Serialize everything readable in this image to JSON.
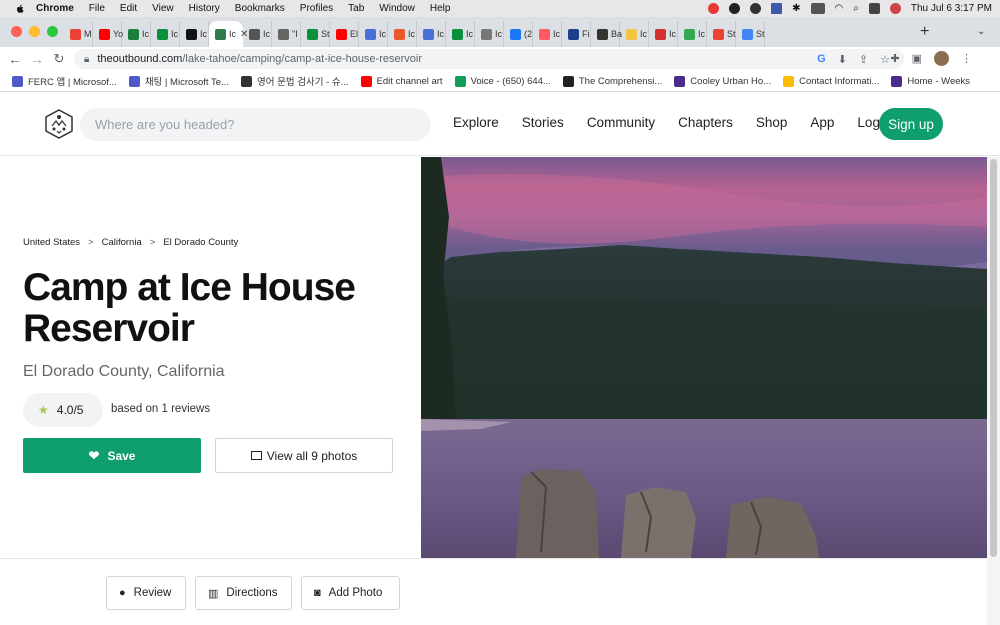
{
  "menubar": {
    "app": "Chrome",
    "items": [
      "File",
      "Edit",
      "View",
      "History",
      "Bookmarks",
      "Profiles",
      "Tab",
      "Window",
      "Help"
    ],
    "clock": "Thu Jul 6  3:17 PM"
  },
  "tabs": [
    {
      "label": "M",
      "color": "#ea4335"
    },
    {
      "label": "Yo",
      "color": "#ff0000"
    },
    {
      "label": "Ic",
      "color": "#1a7f3c"
    },
    {
      "label": "Ic",
      "color": "#0a8f3d"
    },
    {
      "label": "Ic",
      "color": "#111111"
    },
    {
      "label": "Ic",
      "color": "#2f7a4f",
      "active": true
    },
    {
      "label": "Ic",
      "color": "#555555"
    },
    {
      "label": "\"I",
      "color": "#666666"
    },
    {
      "label": "St",
      "color": "#0a8f3d"
    },
    {
      "label": "El",
      "color": "#ff0000"
    },
    {
      "label": "Ic",
      "color": "#4a6fd6"
    },
    {
      "label": "Ic",
      "color": "#e85a2b"
    },
    {
      "label": "Ic",
      "color": "#4a6fd6"
    },
    {
      "label": "Ic",
      "color": "#0a8f3d"
    },
    {
      "label": "Ic",
      "color": "#777777"
    },
    {
      "label": "(2",
      "color": "#1877f2"
    },
    {
      "label": "Ic",
      "color": "#ff5a5f"
    },
    {
      "label": "Fi",
      "color": "#1c3d8a"
    },
    {
      "label": "Ba",
      "color": "#333333"
    },
    {
      "label": "Ic",
      "color": "#f4c542"
    },
    {
      "label": "Ic",
      "color": "#d32f2f"
    },
    {
      "label": "Ic",
      "color": "#34a853"
    },
    {
      "label": "St",
      "color": "#ea4335"
    },
    {
      "label": "St",
      "color": "#4285f4"
    }
  ],
  "address": {
    "domain": "theoutbound.com",
    "path": "/lake-tahoe/camping/camp-at-ice-house-reservoir"
  },
  "bookmarks": [
    {
      "label": "FERC 앱 | Microsof...",
      "color": "#5059c9"
    },
    {
      "label": "채팅 | Microsoft Te...",
      "color": "#5059c9"
    },
    {
      "label": "영어 문법 검사기 - 슈...",
      "color": "#333333"
    },
    {
      "label": "Edit channel art",
      "color": "#ff0000"
    },
    {
      "label": "Voice - (650) 644...",
      "color": "#0f9d58"
    },
    {
      "label": "The Comprehensi...",
      "color": "#222222"
    },
    {
      "label": "Cooley Urban Ho...",
      "color": "#4b2c8a"
    },
    {
      "label": "Contact Informati...",
      "color": "#fbbc04"
    },
    {
      "label": "Home - Weeks",
      "color": "#4b2c8a"
    }
  ],
  "header": {
    "search_placeholder": "Where are you headed?",
    "nav": [
      "Explore",
      "Stories",
      "Community",
      "Chapters",
      "Shop",
      "App",
      "Log in"
    ],
    "signup": "Sign up"
  },
  "breadcrumb": [
    "United States",
    "California",
    "El Dorado County"
  ],
  "page": {
    "title": "Camp at Ice House Reservoir",
    "subtitle": "El Dorado County, California",
    "rating": "4.0/5",
    "reviews": "based on 1 reviews",
    "save": "Save",
    "view_photos": "View all 9 photos"
  },
  "actions": [
    {
      "label": "Review",
      "icon": "comment-icon"
    },
    {
      "label": "Directions",
      "icon": "map-icon"
    },
    {
      "label": "Add Photo",
      "icon": "camera-icon"
    }
  ]
}
